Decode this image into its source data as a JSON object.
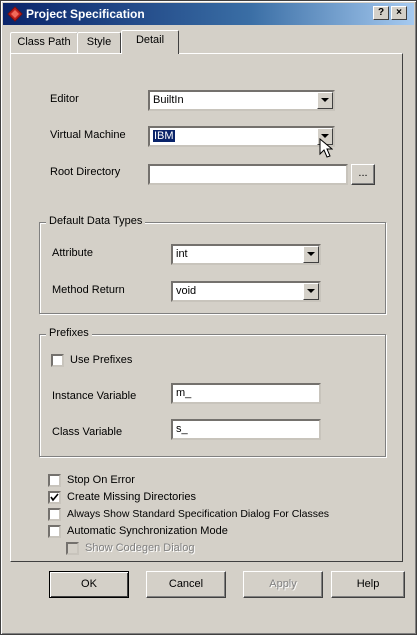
{
  "window": {
    "title": "Project Specification",
    "help_button": "?",
    "close_button": "×"
  },
  "tabs": [
    {
      "label": "Class Path",
      "active": false
    },
    {
      "label": "Style",
      "active": false
    },
    {
      "label": "Detail",
      "active": true
    }
  ],
  "detail": {
    "editor": {
      "label": "Editor",
      "value": "BuiltIn"
    },
    "virtual_machine": {
      "label": "Virtual Machine",
      "value": "IBM"
    },
    "root_directory": {
      "label": "Root Directory",
      "value": "",
      "browse_label": "..."
    },
    "default_data_types": {
      "title": "Default Data Types",
      "attribute": {
        "label": "Attribute",
        "value": "int"
      },
      "method_return": {
        "label": "Method Return",
        "value": "void"
      }
    },
    "prefixes": {
      "title": "Prefixes",
      "use_prefixes": {
        "label": "Use Prefixes",
        "checked": false
      },
      "instance_variable": {
        "label": "Instance Variable",
        "value": "m_"
      },
      "class_variable": {
        "label": "Class Variable",
        "value": "s_"
      }
    },
    "options": [
      {
        "label": "Stop On Error",
        "checked": false,
        "enabled": true
      },
      {
        "label": "Create Missing Directories",
        "checked": true,
        "enabled": true
      },
      {
        "label": "Always Show Standard Specification Dialog For Classes",
        "checked": false,
        "enabled": true
      },
      {
        "label": "Automatic Synchronization Mode",
        "checked": false,
        "enabled": true
      },
      {
        "label": "Show Codegen Dialog",
        "checked": false,
        "enabled": false
      }
    ]
  },
  "buttons": {
    "ok": "OK",
    "cancel": "Cancel",
    "apply": "Apply",
    "help": "Help"
  },
  "icons": {
    "app": "rose-diamond-icon",
    "dropdown": "chevron-down-icon",
    "check": "check-icon",
    "cursor": "mouse-pointer-icon"
  },
  "colors": {
    "titlebar_start": "#0a246a",
    "titlebar_end": "#a6caf0",
    "face": "#d4d0c8",
    "selection": "#0a246a",
    "app_icon": "#c0201e"
  }
}
